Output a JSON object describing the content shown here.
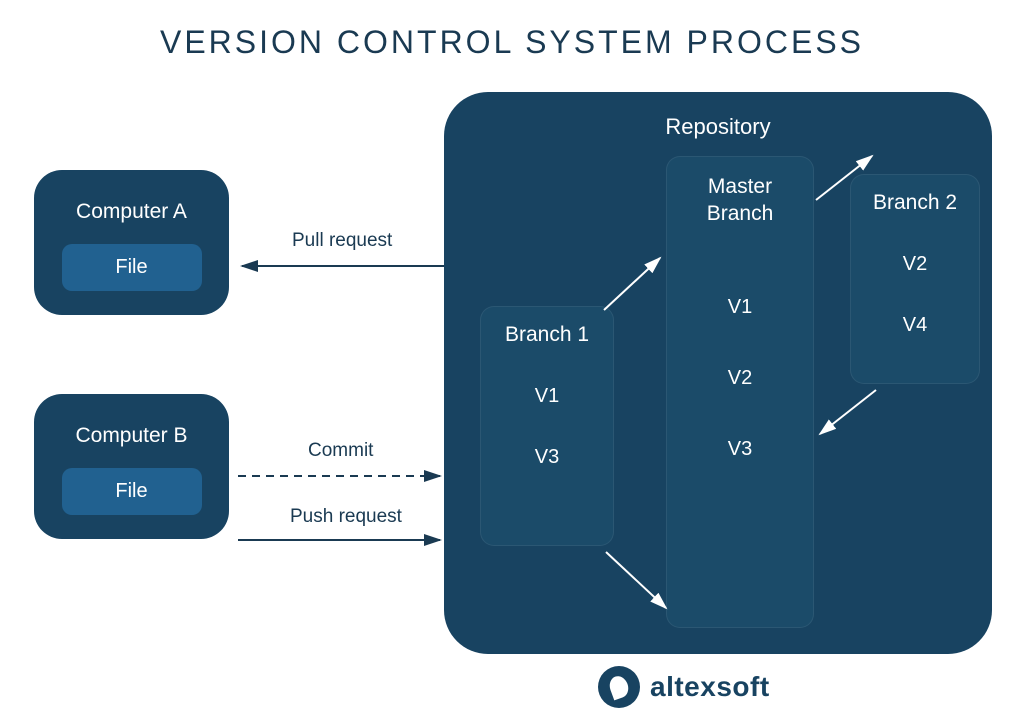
{
  "title": "VERSION CONTROL SYSTEM PROCESS",
  "computers": {
    "a": {
      "label": "Computer A",
      "file": "File"
    },
    "b": {
      "label": "Computer B",
      "file": "File"
    }
  },
  "actions": {
    "pull": "Pull request",
    "commit": "Commit",
    "push": "Push request"
  },
  "repository": {
    "title": "Repository",
    "master": {
      "title": "Master\nBranch",
      "versions": [
        "V1",
        "V2",
        "V3"
      ]
    },
    "branch1": {
      "title": "Branch 1",
      "versions": [
        "V1",
        "V3"
      ]
    },
    "branch2": {
      "title": "Branch 2",
      "versions": [
        "V2",
        "V4"
      ]
    }
  },
  "logo": "altexsoft"
}
